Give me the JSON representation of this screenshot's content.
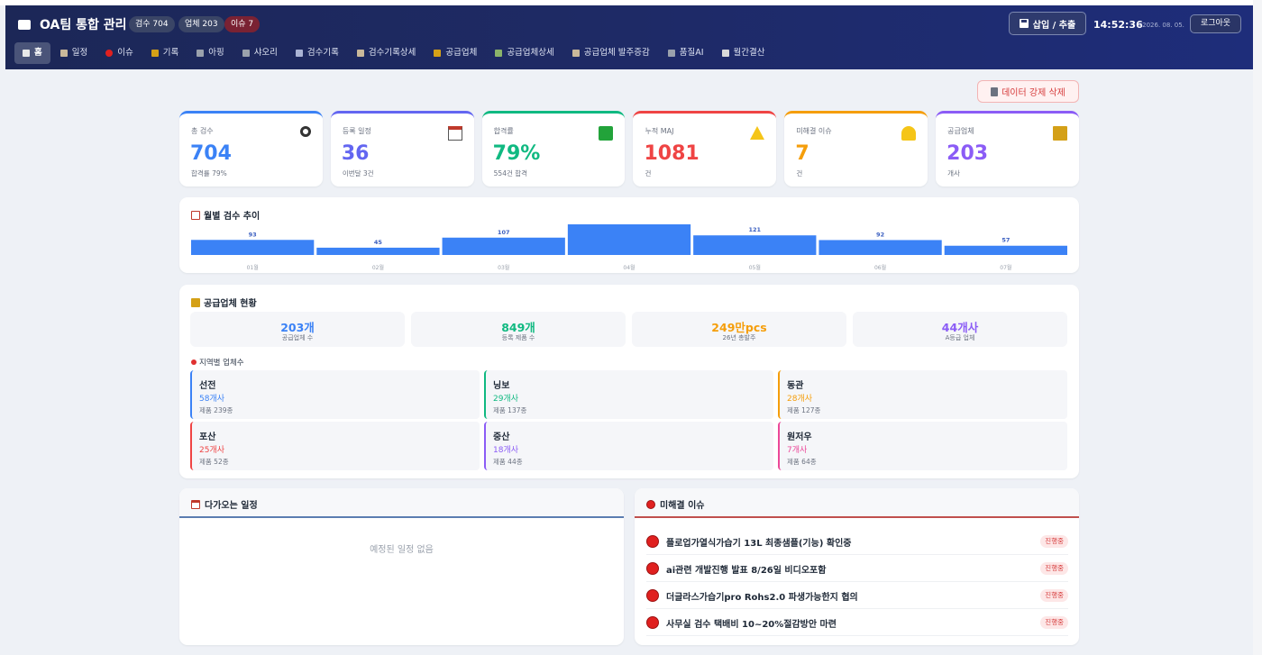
{
  "header": {
    "title": "OA팀 통합 관리",
    "badges": [
      "검수 704",
      "업체 203",
      "이슈 7"
    ],
    "insert_button": "삽입 / 추출",
    "clock": "14:52:36",
    "version": "v2026. 08. 05.",
    "logout": "로그아웃",
    "colors": {
      "background": "#1e2a66",
      "issue_badge": "#7a2233"
    }
  },
  "nav": [
    {
      "label": "홈",
      "icon": "home-icon"
    },
    {
      "label": "일정",
      "icon": "calendar-icon"
    },
    {
      "label": "이슈",
      "icon": "red-circle-icon"
    },
    {
      "label": "기록",
      "icon": "notebook-icon"
    },
    {
      "label": "아핑",
      "icon": "person-icon"
    },
    {
      "label": "샤오리",
      "icon": "person-icon"
    },
    {
      "label": "검수기록",
      "icon": "magnifier-icon"
    },
    {
      "label": "검수기록상세",
      "icon": "chart-icon"
    },
    {
      "label": "공급업체",
      "icon": "factory-icon"
    },
    {
      "label": "공급업체상세",
      "icon": "bar-chart-icon"
    },
    {
      "label": "공급업체 발주증감",
      "icon": "chart-icon"
    },
    {
      "label": "품질AI",
      "icon": "robot-icon"
    },
    {
      "label": "월간결산",
      "icon": "document-icon"
    }
  ],
  "actions": {
    "force_delete": "데이터 강제 삭제"
  },
  "stats": [
    {
      "label": "총 검수",
      "value": "704",
      "sub": "합격률 79%",
      "icon": "magnifier-icon",
      "color": "#3b82f6"
    },
    {
      "label": "등록 일정",
      "value": "36",
      "sub": "이번달 3건",
      "icon": "calendar-icon",
      "color": "#6366f1"
    },
    {
      "label": "합격률",
      "value": "79%",
      "sub": "554건 합격",
      "icon": "check-icon",
      "color": "#10b981"
    },
    {
      "label": "누적 MAJ",
      "value": "1081",
      "sub": "건",
      "icon": "warning-icon",
      "color": "#ef4444"
    },
    {
      "label": "미해결 이슈",
      "value": "7",
      "sub": "건",
      "icon": "bell-icon",
      "color": "#f59e0b"
    },
    {
      "label": "공급업체",
      "value": "203",
      "sub": "개사",
      "icon": "factory-icon",
      "color": "#8b5cf6"
    }
  ],
  "monthly": {
    "title": "월별 검수 추이",
    "bar_color": "#3b82f6"
  },
  "chart_data": {
    "type": "bar",
    "categories": [
      "01월",
      "02월",
      "03월",
      "04월",
      "05월",
      "06월",
      "07월"
    ],
    "values": [
      93,
      45,
      107,
      189,
      121,
      92,
      57
    ],
    "title": "월별 검수 추이",
    "ylim": [
      0,
      189
    ]
  },
  "supplier": {
    "title": "공급업체 현황",
    "summary": [
      {
        "value": "203개",
        "label": "공급업체 수",
        "color": "#3b82f6"
      },
      {
        "value": "849개",
        "label": "등록 제품 수",
        "color": "#10b981"
      },
      {
        "value": "249만pcs",
        "label": "26년 총발주",
        "color": "#f59e0b"
      },
      {
        "value": "44개사",
        "label": "A등급 업체",
        "color": "#8b5cf6"
      }
    ],
    "region_title": "지역별 업체수",
    "regions": [
      {
        "name": "선전",
        "count": "58개사",
        "products": "제품 239종",
        "color": "#3b82f6"
      },
      {
        "name": "닝보",
        "count": "29개사",
        "products": "제품 137종",
        "color": "#10b981"
      },
      {
        "name": "동관",
        "count": "28개사",
        "products": "제품 127종",
        "color": "#f59e0b"
      },
      {
        "name": "포산",
        "count": "25개사",
        "products": "제품 52종",
        "color": "#ef4444"
      },
      {
        "name": "중산",
        "count": "18개사",
        "products": "제품 44종",
        "color": "#8b5cf6"
      },
      {
        "name": "원저우",
        "count": "7개사",
        "products": "제품 64종",
        "color": "#ec4899"
      }
    ]
  },
  "schedule": {
    "title": "다가오는 일정",
    "empty": "예정된 일정 없음"
  },
  "issues": {
    "title": "미해결 이슈",
    "items": [
      {
        "text": "플로업가열식가습기 13L 최종샘플(기능) 확인중",
        "status": "진행중"
      },
      {
        "text": "ai관련 개발진행 발표 8/26일 비디오포함",
        "status": "진행중"
      },
      {
        "text": "더글라스가습기pro Rohs2.0 파생가능한지 협의",
        "status": "진행중"
      },
      {
        "text": "사무실 검수 택배비 10~20%절감방안 마련",
        "status": "진행중"
      }
    ]
  }
}
